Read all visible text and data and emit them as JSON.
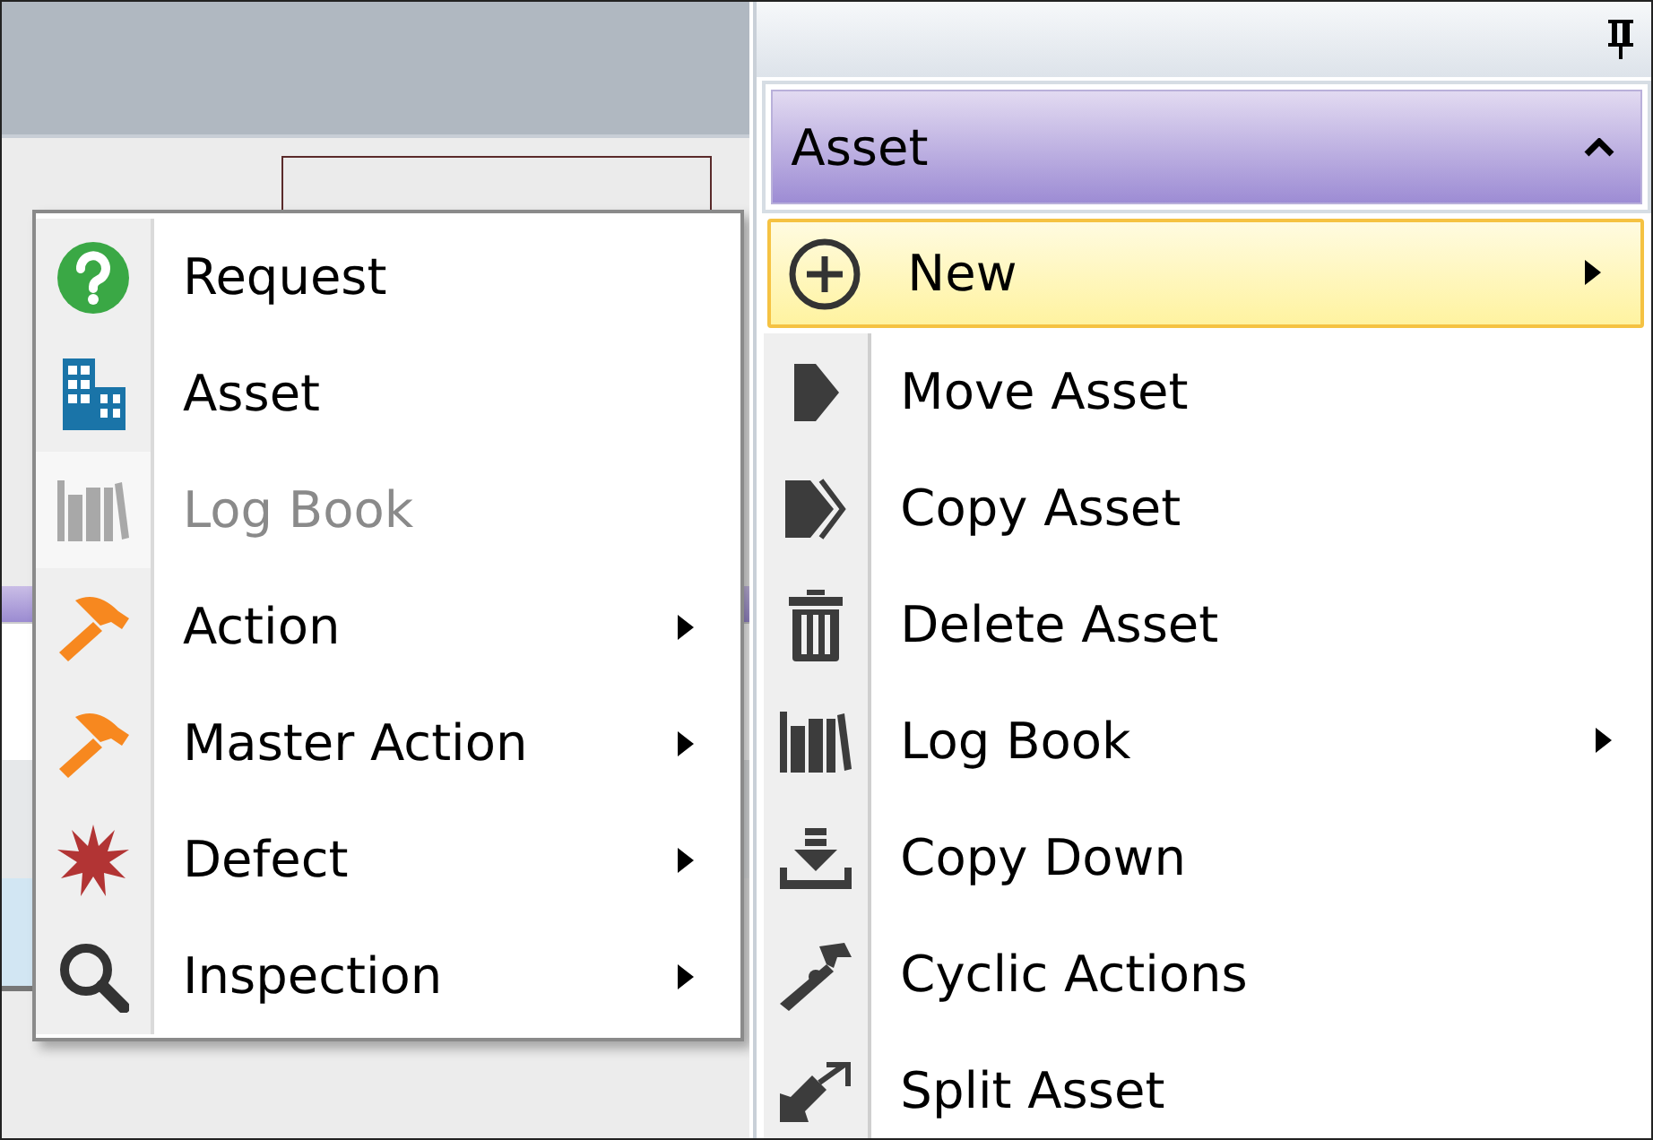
{
  "context_menu": {
    "items": [
      {
        "label": "Request",
        "disabled": false,
        "has_submenu": false
      },
      {
        "label": "Asset",
        "disabled": false,
        "has_submenu": false
      },
      {
        "label": "Log Book",
        "disabled": true,
        "has_submenu": false
      },
      {
        "label": "Action",
        "disabled": false,
        "has_submenu": true
      },
      {
        "label": "Master Action",
        "disabled": false,
        "has_submenu": true
      },
      {
        "label": "Defect",
        "disabled": false,
        "has_submenu": true
      },
      {
        "label": "Inspection",
        "disabled": false,
        "has_submenu": true
      }
    ]
  },
  "side_panel": {
    "section": {
      "title": "Asset",
      "expanded": true
    },
    "items": [
      {
        "label": "New",
        "selected": true,
        "has_submenu": true
      },
      {
        "label": "Move Asset",
        "selected": false,
        "has_submenu": false
      },
      {
        "label": "Copy Asset",
        "selected": false,
        "has_submenu": false
      },
      {
        "label": "Delete Asset",
        "selected": false,
        "has_submenu": false
      },
      {
        "label": "Log Book",
        "selected": false,
        "has_submenu": true
      },
      {
        "label": "Copy Down",
        "selected": false,
        "has_submenu": false
      },
      {
        "label": "Cyclic Actions",
        "selected": false,
        "has_submenu": false
      },
      {
        "label": "Split Asset",
        "selected": false,
        "has_submenu": false
      }
    ]
  }
}
